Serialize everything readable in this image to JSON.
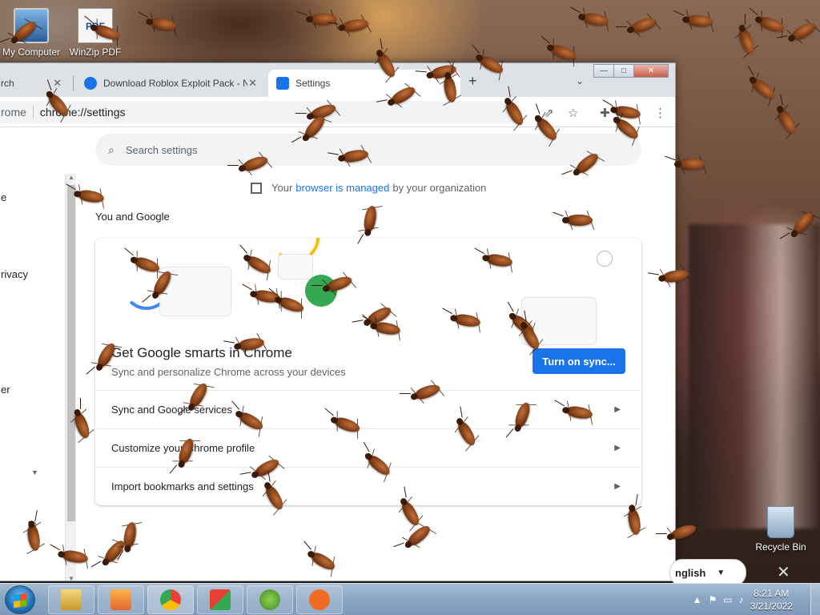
{
  "desktop": {
    "icons": [
      {
        "label": "My Computer"
      },
      {
        "label": "WinZip PDF"
      },
      {
        "label": "Recycle Bin"
      }
    ]
  },
  "browser": {
    "tabs": [
      {
        "label": "rch",
        "active": false
      },
      {
        "label": "Download Roblox Exploit Pack - N",
        "active": false
      },
      {
        "label": "Settings",
        "active": true
      }
    ],
    "new_tab": "+",
    "tab_list": "⌄",
    "omnibox": {
      "prefix": "rome",
      "url": "chrome://settings"
    },
    "window_buttons": [
      "—",
      "□",
      "✕"
    ]
  },
  "settings": {
    "search_placeholder": "Search settings",
    "managed": {
      "before": "Your",
      "link": "browser is managed",
      "after": "by your organization"
    },
    "nav_items": [
      "e",
      "rivacy",
      "er"
    ],
    "section_title": "You and Google",
    "card": {
      "title": "Get Google smarts in Chrome",
      "subtitle": "Sync and personalize Chrome across your devices",
      "button": "Turn on sync...",
      "rows": [
        "Sync and Google services",
        "Customize your Chrome profile",
        "Import bookmarks and settings"
      ]
    }
  },
  "language_popup": {
    "label": "nglish"
  },
  "taskbar": {
    "time": "8:21 AM",
    "date": "3/21/2022"
  },
  "colors": {
    "accent": "#1a73e8",
    "taskbar": "#8aa6c3",
    "roach": "#7a3a14"
  }
}
